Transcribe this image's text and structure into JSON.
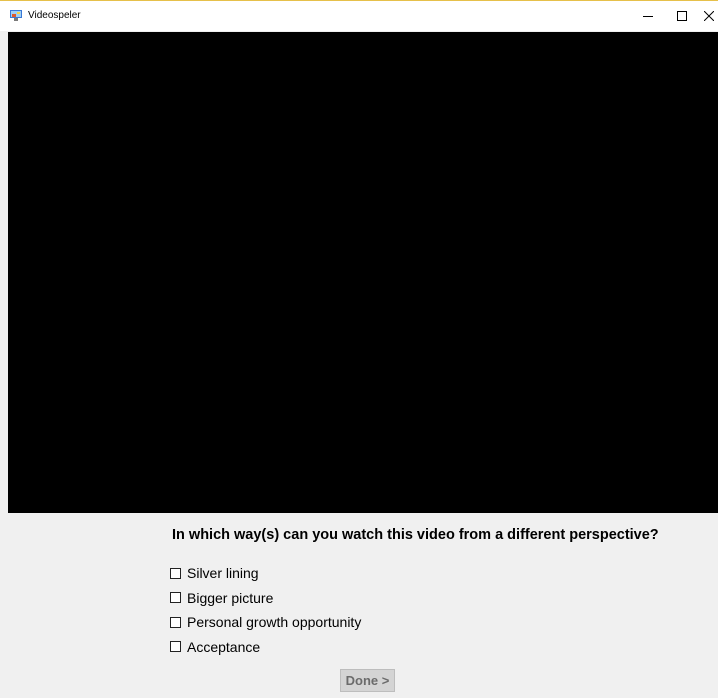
{
  "window": {
    "title": "Videospeler",
    "controls": {
      "minimize_icon": "minimize-icon",
      "maximize_icon": "maximize-icon",
      "close_icon": "close-icon"
    },
    "accent_color": "#e6c04a"
  },
  "video": {
    "background": "#000000"
  },
  "survey": {
    "question": "In which way(s) can you watch this video from a different perspective?",
    "options": [
      {
        "label": "Silver lining",
        "checked": false
      },
      {
        "label": "Bigger picture",
        "checked": false
      },
      {
        "label": "Personal growth opportunity",
        "checked": false
      },
      {
        "label": "Acceptance",
        "checked": false
      }
    ],
    "done_label": "Done >",
    "done_enabled": false
  }
}
